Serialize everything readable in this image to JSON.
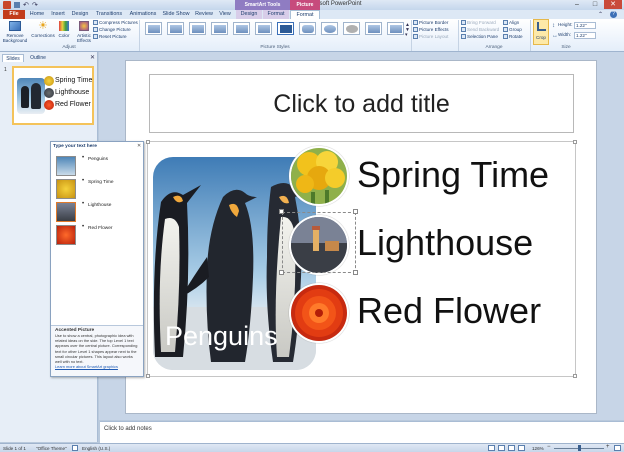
{
  "window": {
    "title": "Presentation1 - Microsoft PowerPoint",
    "context_tabs": [
      "SmartArt Tools",
      "Picture Tools"
    ],
    "controls": [
      "–",
      "□",
      "✕"
    ]
  },
  "tabs": [
    {
      "label": "File"
    },
    {
      "label": "Home"
    },
    {
      "label": "Insert"
    },
    {
      "label": "Design"
    },
    {
      "label": "Transitions"
    },
    {
      "label": "Animations"
    },
    {
      "label": "Slide Show"
    },
    {
      "label": "Review"
    },
    {
      "label": "View"
    },
    {
      "label": "Design"
    },
    {
      "label": "Format"
    },
    {
      "label": "Format"
    }
  ],
  "ribbon": {
    "remove_background": "Remove Background",
    "corrections": "Corrections",
    "color": "Color",
    "artistic_effects": "Artistic Effects",
    "compress": "Compress Pictures",
    "change": "Change Picture",
    "reset": "Reset Picture",
    "adjust_label": "Adjust",
    "picture_styles_label": "Picture Styles",
    "picture_border": "Picture Border",
    "picture_effects": "Picture Effects",
    "picture_layout": "Picture Layout",
    "bring_forward": "Bring Forward",
    "send_backward": "Send Backward",
    "selection_pane": "Selection Pane",
    "align": "Align",
    "group": "Group",
    "rotate": "Rotate",
    "arrange_label": "Arrange",
    "crop": "Crop",
    "height_label": "Height:",
    "height_value": "1.22\"",
    "width_label": "Width:",
    "width_value": "1.22\"",
    "size_label": "Size"
  },
  "left_panel": {
    "tabs": [
      "Slides",
      "Outline"
    ],
    "slide_number": "1",
    "thumb_items": [
      "Spring Time",
      "Lighthouse",
      "Red Flower"
    ]
  },
  "slide": {
    "title_placeholder": "Click to add title",
    "big_picture_label": "Penguins",
    "items": [
      "Spring Time",
      "Lighthouse",
      "Red Flower"
    ]
  },
  "text_pane": {
    "header": "Type your text here",
    "items": [
      "Penguins",
      "Spring Time",
      "Lighthouse",
      "Red Flower"
    ],
    "desc_title": "Accented Picture",
    "desc_body": "Use to show a central, photographic idea with related ideas on the side. The top Level 1 text appears over the central picture. Corresponding text for other Level 1 shapes appear next to the small circular pictures. This layout also works well with no text.",
    "desc_link": "Learn more about SmartArt graphics"
  },
  "notes": {
    "placeholder": "Click to add notes"
  },
  "status": {
    "slide_info": "Slide 1 of 1",
    "theme": "\"Office Theme\"",
    "language": "English (U.S.)",
    "zoom": "126%"
  },
  "colors": {
    "file_tab": "#c23c1c",
    "selection": "#f4c35a",
    "smartart_ctx": "#8f7cc2",
    "picture_ctx": "#c74b7c"
  }
}
